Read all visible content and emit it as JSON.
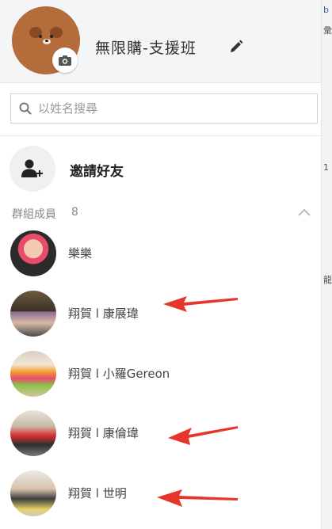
{
  "group": {
    "name": "無限購-支援班"
  },
  "search": {
    "placeholder": "以姓名搜尋"
  },
  "invite": {
    "label": "邀請好友"
  },
  "members_section": {
    "label": "群組成員",
    "count": "8"
  },
  "members": [
    {
      "name": "樂樂"
    },
    {
      "name": "翔賀 l 康展瑋"
    },
    {
      "name": "翔賀 l 小羅Gereon"
    },
    {
      "name": "翔賀 l 康倫瑋"
    },
    {
      "name": "翔賀 l 世明"
    }
  ],
  "colors": {
    "arrow": "#e8352b",
    "header_bg": "#f4f5f7",
    "group_avatar": "#b46c3a"
  },
  "icons": [
    "camera-icon",
    "pencil-icon",
    "search-icon",
    "add-user-icon",
    "chevron-up-icon"
  ]
}
